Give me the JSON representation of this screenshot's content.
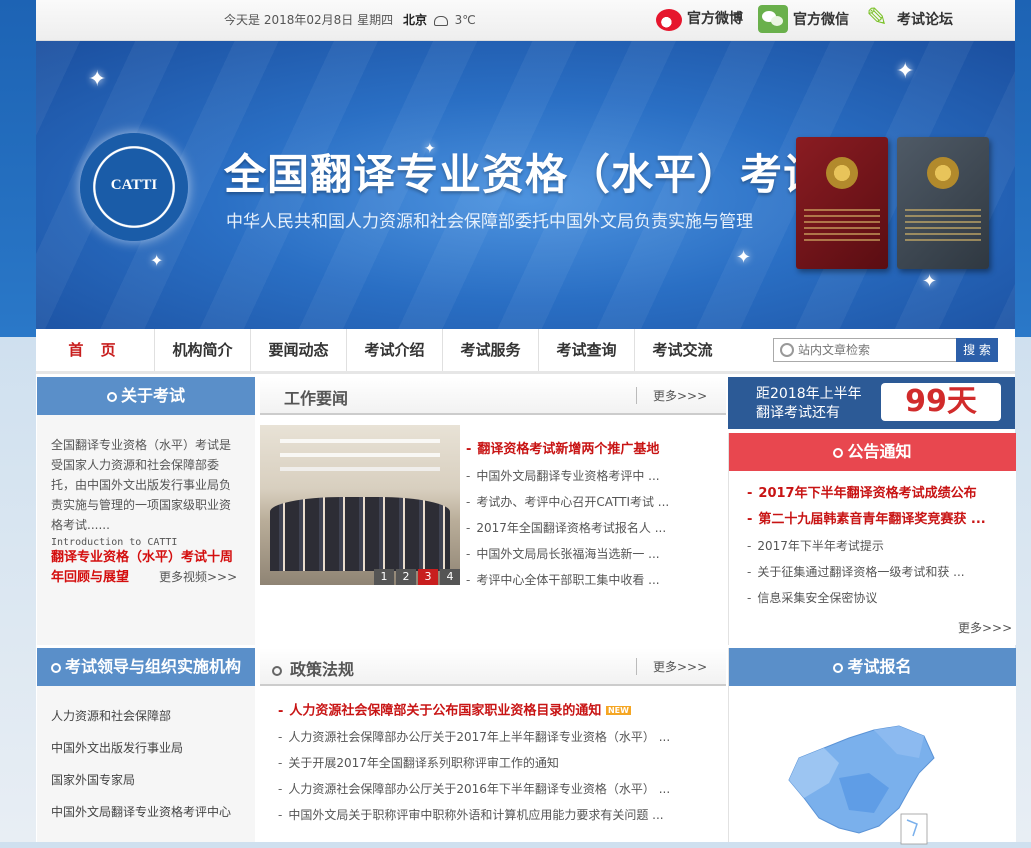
{
  "topbar": {
    "date_prefix": "今天是",
    "date": "2018年02月8日",
    "weekday": "星期四",
    "city": "北京",
    "temp": "3℃",
    "weibo": "官方微博",
    "wechat": "官方微信",
    "forum": "考试论坛"
  },
  "banner": {
    "seal_text": "CATTI",
    "title": "全国翻译专业资格（水平）考试",
    "subtitle": "中华人民共和国人力资源和社会保障部委托中国外文局负责实施与管理"
  },
  "nav": {
    "items": [
      "首 页",
      "机构简介",
      "要闻动态",
      "考试介绍",
      "考试服务",
      "考试查询",
      "考试交流"
    ],
    "search_placeholder": "站内文章检索",
    "search_button": "搜 索"
  },
  "about": {
    "title": "关于考试",
    "text": "全国翻译专业资格（水平）考试是受国家人力资源和社会保障部委托，由中国外文出版发行事业局负责实施与管理的一项国家级职业资格考试......",
    "intro": "Introduction to CATTI",
    "video_link": "翻译专业资格（水平）考试十周年回顾与展望",
    "more_video": "更多视频>>>"
  },
  "work_news": {
    "title": "工作要闻",
    "more": "更多>>>",
    "pager": [
      "1",
      "2",
      "3",
      "4"
    ],
    "items": [
      "翻译资格考试新增两个推广基地",
      "中国外文局翻译专业资格考评中 ...",
      "考试办、考评中心召开CATTI考试 ...",
      "2017年全国翻译资格考试报名人 ...",
      "中国外文局局长张福海当选新一 ...",
      "考评中心全体干部职工集中收看 ..."
    ]
  },
  "countdown": {
    "line1": "距2018年上半年",
    "line2": "翻译考试还有",
    "days": "99天"
  },
  "notice": {
    "title": "公告通知",
    "more": "更多>>>",
    "items": [
      "2017年下半年翻译资格考试成绩公布",
      "第二十九届韩素音青年翻译奖竞赛获 ...",
      "2017年下半年考试提示",
      "关于征集通过翻译资格一级考试和获 ...",
      "信息采集安全保密协议"
    ]
  },
  "org": {
    "title": "考试领导与组织实施机构",
    "items": [
      "人力资源和社会保障部",
      "中国外文出版发行事业局",
      "国家外国专家局",
      "中国外文局翻译专业资格考评中心"
    ]
  },
  "policy": {
    "title": "政策法规",
    "more": "更多>>>",
    "new_badge": "NEW",
    "items": [
      "人力资源社会保障部关于公布国家职业资格目录的通知",
      "人力资源社会保障部办公厅关于2017年上半年翻译专业资格（水平） ...",
      "关于开展2017年全国翻译系列职称评审工作的通知",
      "人力资源社会保障部办公厅关于2016年下半年翻译专业资格（水平） ...",
      "中国外文局关于职称评审中职称外语和计算机应用能力要求有关问题 ..."
    ]
  },
  "register": {
    "title": "考试报名"
  },
  "colors": {
    "accent_blue": "#5a8fc9",
    "accent_red": "#e8474f",
    "link_red": "#c81414",
    "nav_blue": "#2c5fa9"
  }
}
